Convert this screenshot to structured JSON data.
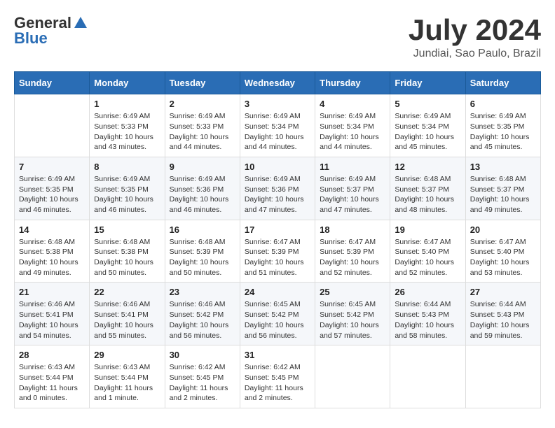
{
  "logo": {
    "general": "General",
    "blue": "Blue"
  },
  "title": {
    "month_year": "July 2024",
    "location": "Jundiai, Sao Paulo, Brazil"
  },
  "headers": [
    "Sunday",
    "Monday",
    "Tuesday",
    "Wednesday",
    "Thursday",
    "Friday",
    "Saturday"
  ],
  "weeks": [
    [
      {
        "day": "",
        "sunrise": "",
        "sunset": "",
        "daylight": ""
      },
      {
        "day": "1",
        "sunrise": "Sunrise: 6:49 AM",
        "sunset": "Sunset: 5:33 PM",
        "daylight": "Daylight: 10 hours and 43 minutes."
      },
      {
        "day": "2",
        "sunrise": "Sunrise: 6:49 AM",
        "sunset": "Sunset: 5:33 PM",
        "daylight": "Daylight: 10 hours and 44 minutes."
      },
      {
        "day": "3",
        "sunrise": "Sunrise: 6:49 AM",
        "sunset": "Sunset: 5:34 PM",
        "daylight": "Daylight: 10 hours and 44 minutes."
      },
      {
        "day": "4",
        "sunrise": "Sunrise: 6:49 AM",
        "sunset": "Sunset: 5:34 PM",
        "daylight": "Daylight: 10 hours and 44 minutes."
      },
      {
        "day": "5",
        "sunrise": "Sunrise: 6:49 AM",
        "sunset": "Sunset: 5:34 PM",
        "daylight": "Daylight: 10 hours and 45 minutes."
      },
      {
        "day": "6",
        "sunrise": "Sunrise: 6:49 AM",
        "sunset": "Sunset: 5:35 PM",
        "daylight": "Daylight: 10 hours and 45 minutes."
      }
    ],
    [
      {
        "day": "7",
        "sunrise": "Sunrise: 6:49 AM",
        "sunset": "Sunset: 5:35 PM",
        "daylight": "Daylight: 10 hours and 46 minutes."
      },
      {
        "day": "8",
        "sunrise": "Sunrise: 6:49 AM",
        "sunset": "Sunset: 5:35 PM",
        "daylight": "Daylight: 10 hours and 46 minutes."
      },
      {
        "day": "9",
        "sunrise": "Sunrise: 6:49 AM",
        "sunset": "Sunset: 5:36 PM",
        "daylight": "Daylight: 10 hours and 46 minutes."
      },
      {
        "day": "10",
        "sunrise": "Sunrise: 6:49 AM",
        "sunset": "Sunset: 5:36 PM",
        "daylight": "Daylight: 10 hours and 47 minutes."
      },
      {
        "day": "11",
        "sunrise": "Sunrise: 6:49 AM",
        "sunset": "Sunset: 5:37 PM",
        "daylight": "Daylight: 10 hours and 47 minutes."
      },
      {
        "day": "12",
        "sunrise": "Sunrise: 6:48 AM",
        "sunset": "Sunset: 5:37 PM",
        "daylight": "Daylight: 10 hours and 48 minutes."
      },
      {
        "day": "13",
        "sunrise": "Sunrise: 6:48 AM",
        "sunset": "Sunset: 5:37 PM",
        "daylight": "Daylight: 10 hours and 49 minutes."
      }
    ],
    [
      {
        "day": "14",
        "sunrise": "Sunrise: 6:48 AM",
        "sunset": "Sunset: 5:38 PM",
        "daylight": "Daylight: 10 hours and 49 minutes."
      },
      {
        "day": "15",
        "sunrise": "Sunrise: 6:48 AM",
        "sunset": "Sunset: 5:38 PM",
        "daylight": "Daylight: 10 hours and 50 minutes."
      },
      {
        "day": "16",
        "sunrise": "Sunrise: 6:48 AM",
        "sunset": "Sunset: 5:39 PM",
        "daylight": "Daylight: 10 hours and 50 minutes."
      },
      {
        "day": "17",
        "sunrise": "Sunrise: 6:47 AM",
        "sunset": "Sunset: 5:39 PM",
        "daylight": "Daylight: 10 hours and 51 minutes."
      },
      {
        "day": "18",
        "sunrise": "Sunrise: 6:47 AM",
        "sunset": "Sunset: 5:39 PM",
        "daylight": "Daylight: 10 hours and 52 minutes."
      },
      {
        "day": "19",
        "sunrise": "Sunrise: 6:47 AM",
        "sunset": "Sunset: 5:40 PM",
        "daylight": "Daylight: 10 hours and 52 minutes."
      },
      {
        "day": "20",
        "sunrise": "Sunrise: 6:47 AM",
        "sunset": "Sunset: 5:40 PM",
        "daylight": "Daylight: 10 hours and 53 minutes."
      }
    ],
    [
      {
        "day": "21",
        "sunrise": "Sunrise: 6:46 AM",
        "sunset": "Sunset: 5:41 PM",
        "daylight": "Daylight: 10 hours and 54 minutes."
      },
      {
        "day": "22",
        "sunrise": "Sunrise: 6:46 AM",
        "sunset": "Sunset: 5:41 PM",
        "daylight": "Daylight: 10 hours and 55 minutes."
      },
      {
        "day": "23",
        "sunrise": "Sunrise: 6:46 AM",
        "sunset": "Sunset: 5:42 PM",
        "daylight": "Daylight: 10 hours and 56 minutes."
      },
      {
        "day": "24",
        "sunrise": "Sunrise: 6:45 AM",
        "sunset": "Sunset: 5:42 PM",
        "daylight": "Daylight: 10 hours and 56 minutes."
      },
      {
        "day": "25",
        "sunrise": "Sunrise: 6:45 AM",
        "sunset": "Sunset: 5:42 PM",
        "daylight": "Daylight: 10 hours and 57 minutes."
      },
      {
        "day": "26",
        "sunrise": "Sunrise: 6:44 AM",
        "sunset": "Sunset: 5:43 PM",
        "daylight": "Daylight: 10 hours and 58 minutes."
      },
      {
        "day": "27",
        "sunrise": "Sunrise: 6:44 AM",
        "sunset": "Sunset: 5:43 PM",
        "daylight": "Daylight: 10 hours and 59 minutes."
      }
    ],
    [
      {
        "day": "28",
        "sunrise": "Sunrise: 6:43 AM",
        "sunset": "Sunset: 5:44 PM",
        "daylight": "Daylight: 11 hours and 0 minutes."
      },
      {
        "day": "29",
        "sunrise": "Sunrise: 6:43 AM",
        "sunset": "Sunset: 5:44 PM",
        "daylight": "Daylight: 11 hours and 1 minute."
      },
      {
        "day": "30",
        "sunrise": "Sunrise: 6:42 AM",
        "sunset": "Sunset: 5:45 PM",
        "daylight": "Daylight: 11 hours and 2 minutes."
      },
      {
        "day": "31",
        "sunrise": "Sunrise: 6:42 AM",
        "sunset": "Sunset: 5:45 PM",
        "daylight": "Daylight: 11 hours and 2 minutes."
      },
      {
        "day": "",
        "sunrise": "",
        "sunset": "",
        "daylight": ""
      },
      {
        "day": "",
        "sunrise": "",
        "sunset": "",
        "daylight": ""
      },
      {
        "day": "",
        "sunrise": "",
        "sunset": "",
        "daylight": ""
      }
    ]
  ]
}
